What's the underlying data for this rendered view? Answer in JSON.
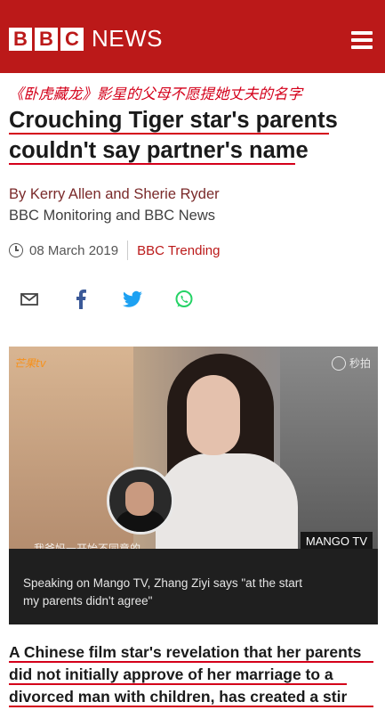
{
  "header": {
    "logo_letters": [
      "B",
      "B",
      "C"
    ],
    "logo_text": "NEWS",
    "menu_icon": "hamburger-menu-icon",
    "brand_color": "#bb1919"
  },
  "article": {
    "chinese_title": "《卧虎藏龙》影星的父母不愿提她丈夫的名字",
    "headline_line1": "Crouching Tiger star's parents",
    "headline_line2": "couldn't say partner's name",
    "byline": "By Kerry Allen and Sherie Ryder",
    "source": "BBC Monitoring and BBC News",
    "date": "08 March 2019",
    "section_link": "BBC Trending",
    "intro_line1": "A Chinese film star's revelation that her parents",
    "intro_line2": "did not initially approve of her marriage to a",
    "intro_line3": "divorced man with children, has created a stir",
    "annotation_color": "#d4001a"
  },
  "share": {
    "icons": [
      "email-icon",
      "facebook-icon",
      "twitter-icon",
      "whatsapp-icon"
    ]
  },
  "media": {
    "watermark_left": "芒果tv",
    "watermark_right": "秒拍",
    "subtitle_zh": "我爸妈一开始不同意的",
    "badge": "MANGO TV",
    "caption_line1": "Speaking on Mango TV, Zhang Ziyi says \"at the start",
    "caption_line2": "my parents didn't agree\""
  }
}
